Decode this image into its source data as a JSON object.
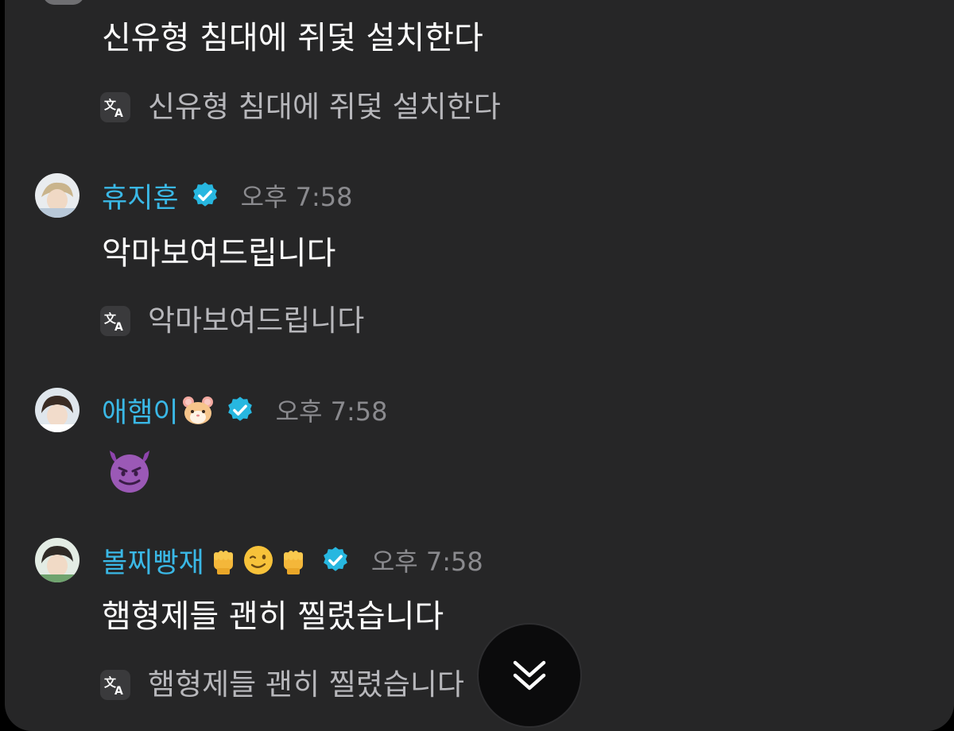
{
  "messages": [
    {
      "text": "신유형 침대에 쥐덫 설치한다",
      "translation": "신유형 침대에 쥐덫 설치한다"
    },
    {
      "author": "휴지훈",
      "time": "오후 7:58",
      "text": "악마보여드립니다",
      "translation": "악마보여드립니다"
    },
    {
      "author": "애햄이",
      "author_emoji": [
        "hamster-face"
      ],
      "time": "오후 7:58",
      "emoji_message": "smiling-face-with-horns"
    },
    {
      "author": "볼찌빵재",
      "author_emoji": [
        "raised-fist",
        "winking-face",
        "raised-fist"
      ],
      "time": "오후 7:58",
      "text": "햄형제들 괜히 찔렸습니다",
      "translation": "햄형제들 괜히 찔렸습니다"
    }
  ],
  "icons": {
    "translate": "translate-icon",
    "verified": "verified-badge-icon",
    "scroll_down": "double-chevron-down-icon"
  },
  "colors": {
    "background": "#262627",
    "author_name": "#3ab8e6",
    "verified": "#27b7e0",
    "message_text": "#ffffff",
    "translation_text": "#b7b7bb",
    "timestamp": "#8a8a8e"
  }
}
